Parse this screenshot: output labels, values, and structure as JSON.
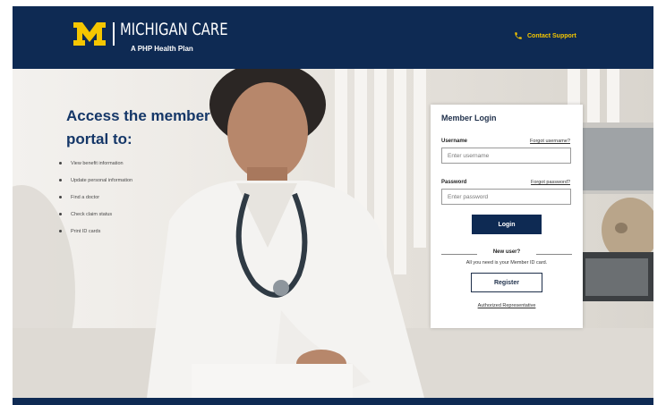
{
  "header": {
    "brand_name": "MICHIGAN CARE",
    "brand_tagline": "A PHP Health Plan",
    "contact_label": "Contact Support",
    "accent_color": "#f5c600",
    "brand_color": "#0e2a53"
  },
  "hero": {
    "title": "Access the member portal to:",
    "bullets": [
      "View benefit information",
      "Update personal information",
      "Find a doctor",
      "Check claim status",
      "Print ID cards"
    ]
  },
  "login": {
    "title": "Member Login",
    "username_label": "Username",
    "forgot_username": "Forgot username?",
    "username_placeholder": "Enter username",
    "password_label": "Password",
    "forgot_password": "Forgot password?",
    "password_placeholder": "Enter password",
    "login_button": "Login",
    "new_user_title": "New user?",
    "new_user_text": "All you need is your Member ID card.",
    "register_button": "Register",
    "authorized_rep_link": "Authorized Representative"
  },
  "icons": {
    "phone": "phone-icon",
    "logo": "block-m-logo"
  }
}
